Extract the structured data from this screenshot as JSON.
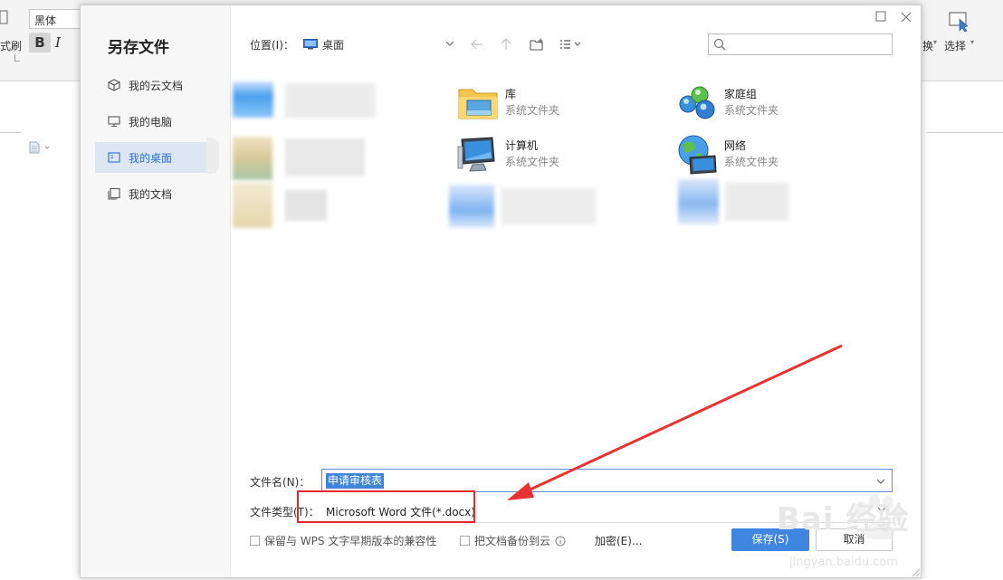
{
  "app": {
    "font_name": "黑体",
    "left_cut_label": "式刷",
    "right_cut_label": "换",
    "select_label": "选择",
    "bold_label": "B",
    "italic_label": "I"
  },
  "dialog": {
    "title": "另存文件",
    "sidebar": [
      {
        "label": "我的云文档",
        "icon": "cloud-cube-icon"
      },
      {
        "label": "我的电脑",
        "icon": "monitor-icon"
      },
      {
        "label": "我的桌面",
        "icon": "desktop-icon",
        "active": true
      },
      {
        "label": "我的文档",
        "icon": "documents-icon"
      }
    ],
    "location_label": "位置(I)：",
    "location_value": "桌面",
    "search_placeholder": "",
    "files": [
      {
        "name": "库",
        "type": "系统文件夹",
        "icon": "library-folder-icon"
      },
      {
        "name": "家庭组",
        "type": "系统文件夹",
        "icon": "homegroup-icon"
      },
      {
        "name": "计算机",
        "type": "系统文件夹",
        "icon": "computer-icon"
      },
      {
        "name": "网络",
        "type": "系统文件夹",
        "icon": "network-icon"
      }
    ],
    "filename_label": "文件名(N)：",
    "filename_value": "申请审核表",
    "filetype_label": "文件类型(T)：",
    "filetype_value": "Microsoft Word 文件(*.docx)",
    "compat_checkbox": "保留与 WPS 文字早期版本的兼容性",
    "backup_checkbox": "把文档备份到云",
    "encrypt_link": "加密(E)...",
    "save_button": "保存(S)",
    "cancel_button": "取消"
  },
  "watermark": {
    "text": "Bai 经验",
    "url": "jingyan.baidu.com"
  },
  "colors": {
    "accent": "#3f86e0",
    "highlight_red": "#e32b2b",
    "sidebar_active_bg": "#dde6f3"
  }
}
